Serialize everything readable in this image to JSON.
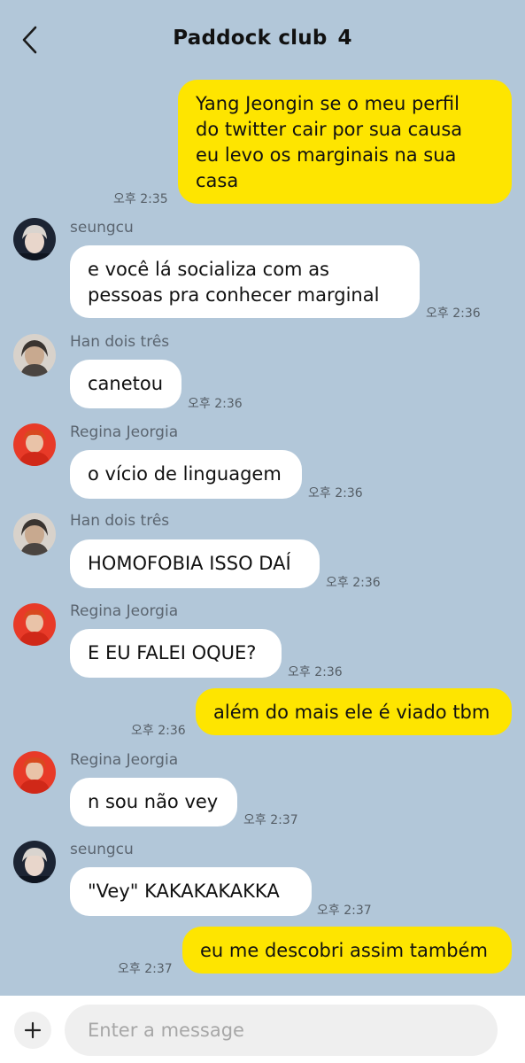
{
  "header": {
    "title": "Paddock club",
    "member_count": "4"
  },
  "messages": [
    {
      "side": "me",
      "text": "Yang Jeongin se o meu perfil\ndo twitter cair por sua causa\neu levo os marginais na sua\ncasa",
      "time": "오후 2:35"
    },
    {
      "side": "them",
      "sender": "seungcu",
      "avatar": "seungcu-avatar",
      "text": "e você lá socializa com as\npessoas pra conhecer marginal",
      "time": "오후 2:36"
    },
    {
      "side": "them",
      "sender": "Han dois três",
      "avatar": "han-avatar",
      "text": "canetou",
      "time": "오후 2:36"
    },
    {
      "side": "them",
      "sender": "Regina Jeorgia",
      "avatar": "regina-avatar",
      "text": "o vício de linguagem",
      "time": "오후 2:36"
    },
    {
      "side": "them",
      "sender": "Han dois três",
      "avatar": "han-avatar",
      "text": "HOMOFOBIA ISSO DAÍ",
      "time": "오후 2:36"
    },
    {
      "side": "them",
      "sender": "Regina Jeorgia",
      "avatar": "regina-avatar",
      "text": "E EU FALEI OQUE?",
      "time": "오후 2:36"
    },
    {
      "side": "me",
      "text": "além do mais ele é viado tbm",
      "time": "오후 2:36"
    },
    {
      "side": "them",
      "sender": "Regina Jeorgia",
      "avatar": "regina-avatar",
      "text": "n sou não vey",
      "time": "오후 2:37"
    },
    {
      "side": "them",
      "sender": "seungcu",
      "avatar": "seungcu-avatar",
      "text": "\"Vey\" KAKAKAKAKKA",
      "time": "오후 2:37"
    },
    {
      "side": "me",
      "text": "eu me descobri assim também",
      "time": "오후 2:37"
    }
  ],
  "composer": {
    "placeholder": "Enter a message",
    "value": ""
  },
  "icons": {
    "back": "chevron-left-icon",
    "attach": "plus-icon"
  },
  "colors": {
    "background": "#b2c7d9",
    "my_bubble": "#fee500",
    "their_bubble": "#ffffff"
  }
}
